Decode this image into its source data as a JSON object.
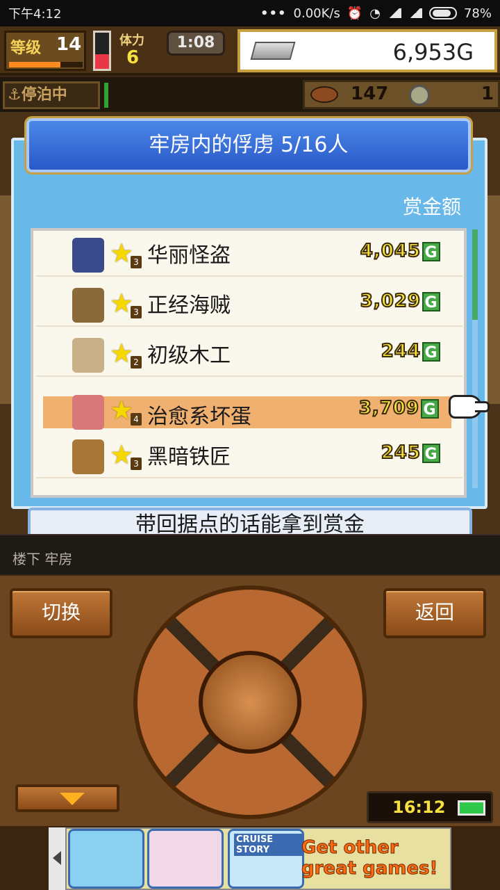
{
  "status_bar": {
    "time": "下午4:12",
    "net_speed": "0.00K/s",
    "battery": "78%"
  },
  "hud": {
    "level_label": "等级",
    "level_value": "14",
    "level_progress": 0.7,
    "hp_fill": 0.4,
    "stamina_label": "体力",
    "stamina_value": "6",
    "clock": "1:08",
    "gold": "6,953G",
    "dock_status": "停泊中",
    "food_value": "147",
    "coin_value": "1"
  },
  "dialog": {
    "title": "牢房内的俘虏  5/16人",
    "bounty_header": "赏金额",
    "prisoners": [
      {
        "name": "华丽怪盗",
        "rank": "3",
        "bounty": "4,045",
        "avatar_color": "#3a4a8a"
      },
      {
        "name": "正经海贼",
        "rank": "3",
        "bounty": "3,029",
        "avatar_color": "#8a6a3a"
      },
      {
        "name": "初级木工",
        "rank": "2",
        "bounty": "244",
        "avatar_color": "#c8b088"
      },
      {
        "name": "治愈系坏蛋",
        "rank": "4",
        "bounty": "3,709",
        "avatar_color": "#d87878"
      },
      {
        "name": "黑暗铁匠",
        "rank": "3",
        "bounty": "245",
        "avatar_color": "#a87838"
      }
    ],
    "selected_index": 3,
    "currency_badge": "G",
    "footer": "带回据点的话能拿到赏金"
  },
  "location": "楼下 牢房",
  "controls": {
    "switch_label": "切换",
    "back_label": "返回",
    "game_time": "16:12"
  },
  "ad": {
    "cruise_label": "CRUISE STORY",
    "cta": "Get other great games!"
  },
  "colors": {
    "dialog_blue": "#69b8ea",
    "title_blue": "#2a58c8",
    "selected_row": "#f0b070",
    "bounty_gold": "#f5e040"
  }
}
